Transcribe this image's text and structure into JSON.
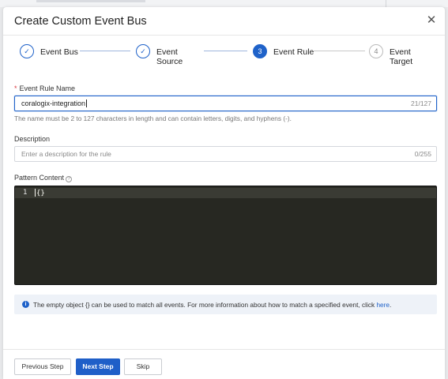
{
  "dialog": {
    "title": "Create Custom Event Bus",
    "close_icon": "close-icon"
  },
  "steps": [
    {
      "state": "completed",
      "icon": "check-icon",
      "label": "Event Bus"
    },
    {
      "state": "completed",
      "icon": "check-icon",
      "label": "Event Source"
    },
    {
      "state": "active",
      "number": "3",
      "label": "Event Rule"
    },
    {
      "state": "pending",
      "number": "4",
      "label": "Event Target"
    }
  ],
  "rule_name": {
    "required_mark": "*",
    "label": "Event Rule Name",
    "value": "coralogix-integration",
    "counter": "21/127",
    "hint": "The name must be 2 to 127 characters in length and can contain letters, digits, and hyphens (-)."
  },
  "description": {
    "label": "Description",
    "placeholder": "Enter a description for the rule",
    "counter": "0/255"
  },
  "pattern": {
    "label": "Pattern Content",
    "help_icon": "question-circle-icon",
    "line_number": "1",
    "code": "{}"
  },
  "info": {
    "icon": "info-icon",
    "text": "The empty object {} can be used to match all events. For more information about how to match a specified event, click",
    "link": "here",
    "suffix": "."
  },
  "footer": {
    "previous_label": "Previous Step",
    "next_label": "Next Step",
    "skip_label": "Skip"
  },
  "colors": {
    "accent": "#1f62c9",
    "editor_bg": "#272822",
    "required": "#d9363e"
  }
}
